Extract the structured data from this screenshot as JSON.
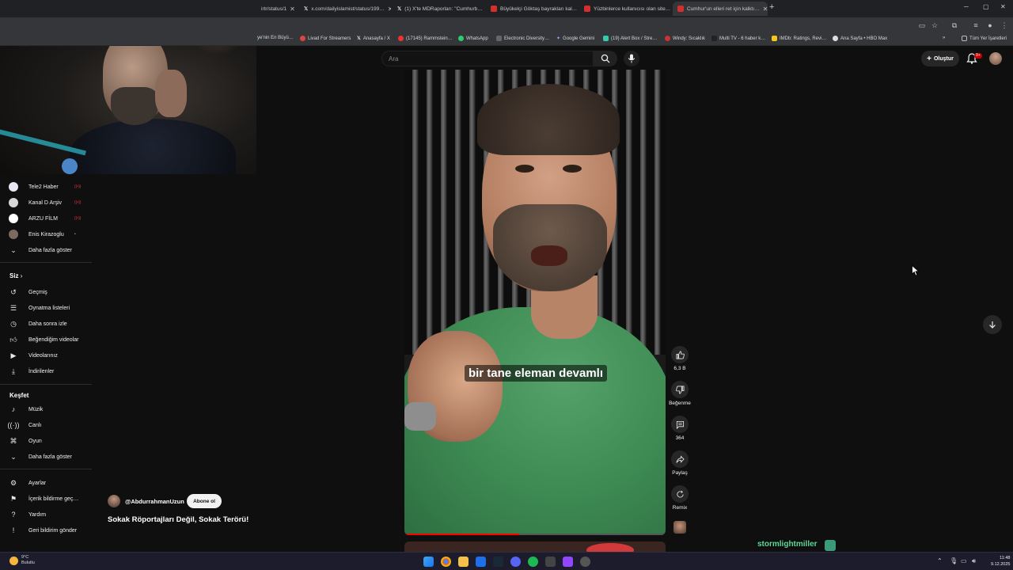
{
  "browser": {
    "tabs": [
      {
        "title": "irtr/status/1",
        "color": "#3c3c3c"
      },
      {
        "title": "x.com/dailyislamist/status/199…",
        "color": "#000000"
      },
      {
        "title": "(1) X'te MDRaporları: \"Cumhurb…",
        "color": "#000000"
      },
      {
        "title": "Büyükelçi Göktaş bayrakları kal…",
        "color": "#d32f2f"
      },
      {
        "title": "Yüzbinlerce kullanıcısı olan site…",
        "color": "#d32f2f"
      },
      {
        "title": "Cumhur'un elleri ret için kalktı…",
        "color": "#d32f2f"
      }
    ],
    "bookmarks": [
      "ye'nin En Büyü…",
      "Livad For Streamers",
      "Anasayfa / X",
      "(17145) Rammstein…",
      "WhatsApp",
      "Electronic Diversity…",
      "Google Gemini",
      "(19) Alert Box / Stre…",
      "Windy: Sıcaklık",
      "Multi TV - 6 haber k…",
      "IMDb: Ratings, Revi…",
      "Ana Sayfa • HBO Max"
    ],
    "all_bookmarks": "Tüm Yer İşaretleri"
  },
  "header": {
    "search_placeholder": "Ara",
    "create_label": "Oluştur",
    "notification_count": "9+"
  },
  "sidebar": {
    "subscriptions": [
      {
        "label": "Tele2 Haber",
        "color": "#e8e8f4"
      },
      {
        "label": "Kanal D Arşiv",
        "color": "#d8d8d8"
      },
      {
        "label": "ARZU FİLM",
        "color": "#ffffff"
      },
      {
        "label": "Enis Kirazoglu",
        "color": "#7a6a60"
      }
    ],
    "show_more_1": "Daha fazla göster",
    "you_heading": "Siz",
    "you_items": [
      {
        "label": "Geçmiş",
        "icon": "history-icon"
      },
      {
        "label": "Oynatma listeleri",
        "icon": "playlist-icon"
      },
      {
        "label": "Daha sonra izle",
        "icon": "clock-icon"
      },
      {
        "label": "Beğendiğim videolar",
        "icon": "like-icon"
      },
      {
        "label": "Videolarınız",
        "icon": "video-icon"
      },
      {
        "label": "İndirilenler",
        "icon": "download-icon"
      }
    ],
    "explore_heading": "Keşfet",
    "explore_items": [
      {
        "label": "Müzik",
        "icon": "music-icon"
      },
      {
        "label": "Canlı",
        "icon": "live-icon"
      },
      {
        "label": "Oyun",
        "icon": "gaming-icon"
      }
    ],
    "show_more_2": "Daha fazla göster",
    "footer_items": [
      {
        "label": "Ayarlar",
        "icon": "gear-icon"
      },
      {
        "label": "İçerik bildirme geç…",
        "icon": "flag-icon"
      },
      {
        "label": "Yardım",
        "icon": "help-icon"
      },
      {
        "label": "Geri bildirim gönder",
        "icon": "feedback-icon"
      }
    ]
  },
  "short": {
    "caption": "bir tane eleman devamlı",
    "progress": 0.44,
    "likes": "6,3 B",
    "dislike_label": "Beğenme",
    "comments": "364",
    "share_label": "Paylaş",
    "remix_label": "Remix",
    "channel": "@AbdurrahmanUzun",
    "subscribe_label": "Abone ol",
    "title": "Sokak Röportajları Değil, Sokak Terörü!"
  },
  "overlay": {
    "user_1": "stormlightmiller",
    "user_2": "stormlightmiller",
    "accent": "#5fdc9d"
  },
  "taskbar": {
    "temperature": "9°C",
    "weather": "Bulutlu",
    "time": "11:48",
    "date": "9.12.2025"
  }
}
